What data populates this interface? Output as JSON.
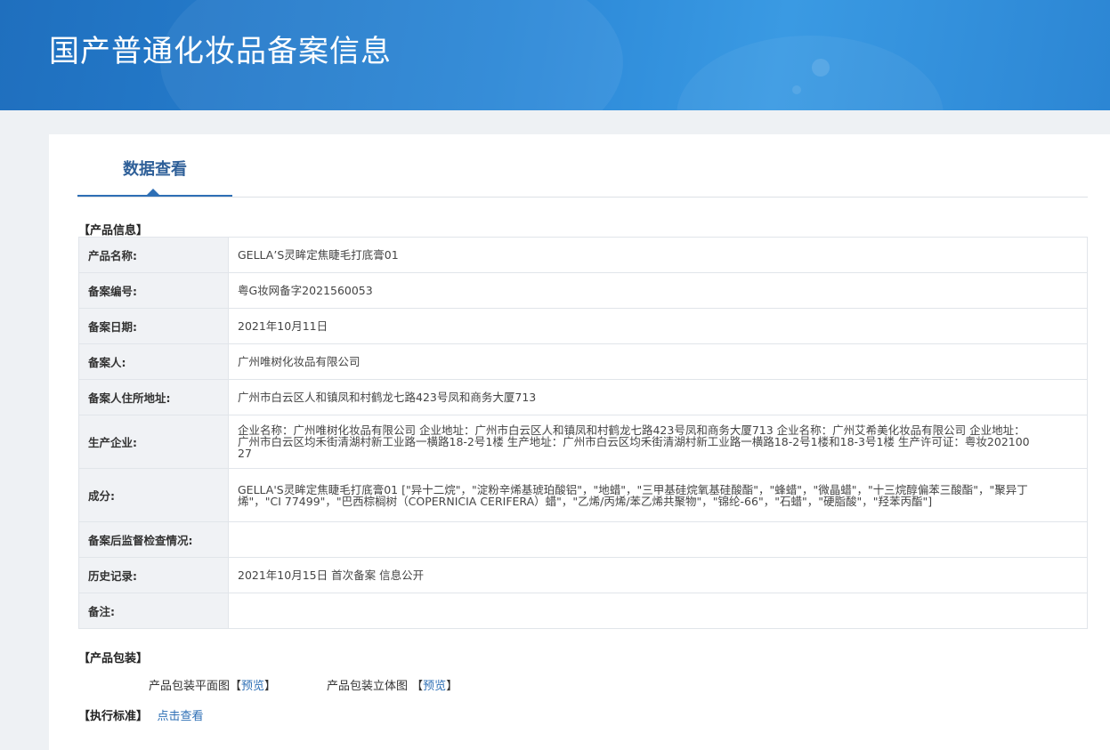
{
  "header": {
    "title": "国产普通化妆品备案信息"
  },
  "tabs": [
    {
      "label": "数据查看"
    }
  ],
  "sections": {
    "product_info": "【产品信息】",
    "packaging": "【产品包装】",
    "standard": "【执行标准】"
  },
  "product_info_rows": [
    {
      "key": "产品名称:",
      "value": "GELLA’S灵眸定焦睫毛打底膏01"
    },
    {
      "key": "备案编号:",
      "value": "粤G妆网备字2021560053"
    },
    {
      "key": "备案日期:",
      "value": "2021年10月11日"
    },
    {
      "key": "备案人:",
      "value": "广州唯树化妆品有限公司"
    },
    {
      "key": "备案人住所地址:",
      "value": "广州市白云区人和镇凤和村鹤龙七路423号凤和商务大厦713"
    },
    {
      "key": "生产企业:",
      "value": "企业名称：广州唯树化妆品有限公司 企业地址：广州市白云区人和镇凤和村鹤龙七路423号凤和商务大厦713 企业名称：广州艾希美化妆品有限公司 企业地址：广州市白云区均禾街清湖村新工业路一横路18-2号1楼 生产地址：广州市白云区均禾街清湖村新工业路一横路18-2号1楼和18-3号1楼 生产许可证：粤妆20210027"
    },
    {
      "key": "成分:",
      "value": "GELLA'S灵眸定焦睫毛打底膏01 [\"异十二烷\"，\"淀粉辛烯基琥珀酸铝\"，\"地蜡\"，\"三甲基硅烷氧基硅酸酯\"，\"蜂蜡\"，\"微晶蜡\"，\"十三烷醇偏苯三酸酯\"，\"聚异丁烯\"，\"CI 77499\"，\"巴西棕榈树（COPERNICIA CERIFERA）蜡\"，\"乙烯/丙烯/苯乙烯共聚物\"，\"锦纶-66\"，\"石蜡\"，\"硬脂酸\"，\"羟苯丙酯\"]"
    },
    {
      "key": "备案后监督检查情况:",
      "value": ""
    },
    {
      "key": "历史记录:",
      "value": "2021年10月15日 首次备案 信息公开"
    },
    {
      "key": "备注:",
      "value": ""
    }
  ],
  "packaging": {
    "flat_label": "产品包装平面图",
    "flat_open": "【",
    "flat_link": "预览",
    "flat_close": "】",
    "solid_label": "产品包装立体图",
    "solid_open": "【",
    "solid_link": "预览",
    "solid_close": "】"
  },
  "standard": {
    "link": "点击查看"
  },
  "colors": {
    "banner": "#2a86d6",
    "accent": "#2e6fb5",
    "key_bg": "#f0f2f5"
  }
}
